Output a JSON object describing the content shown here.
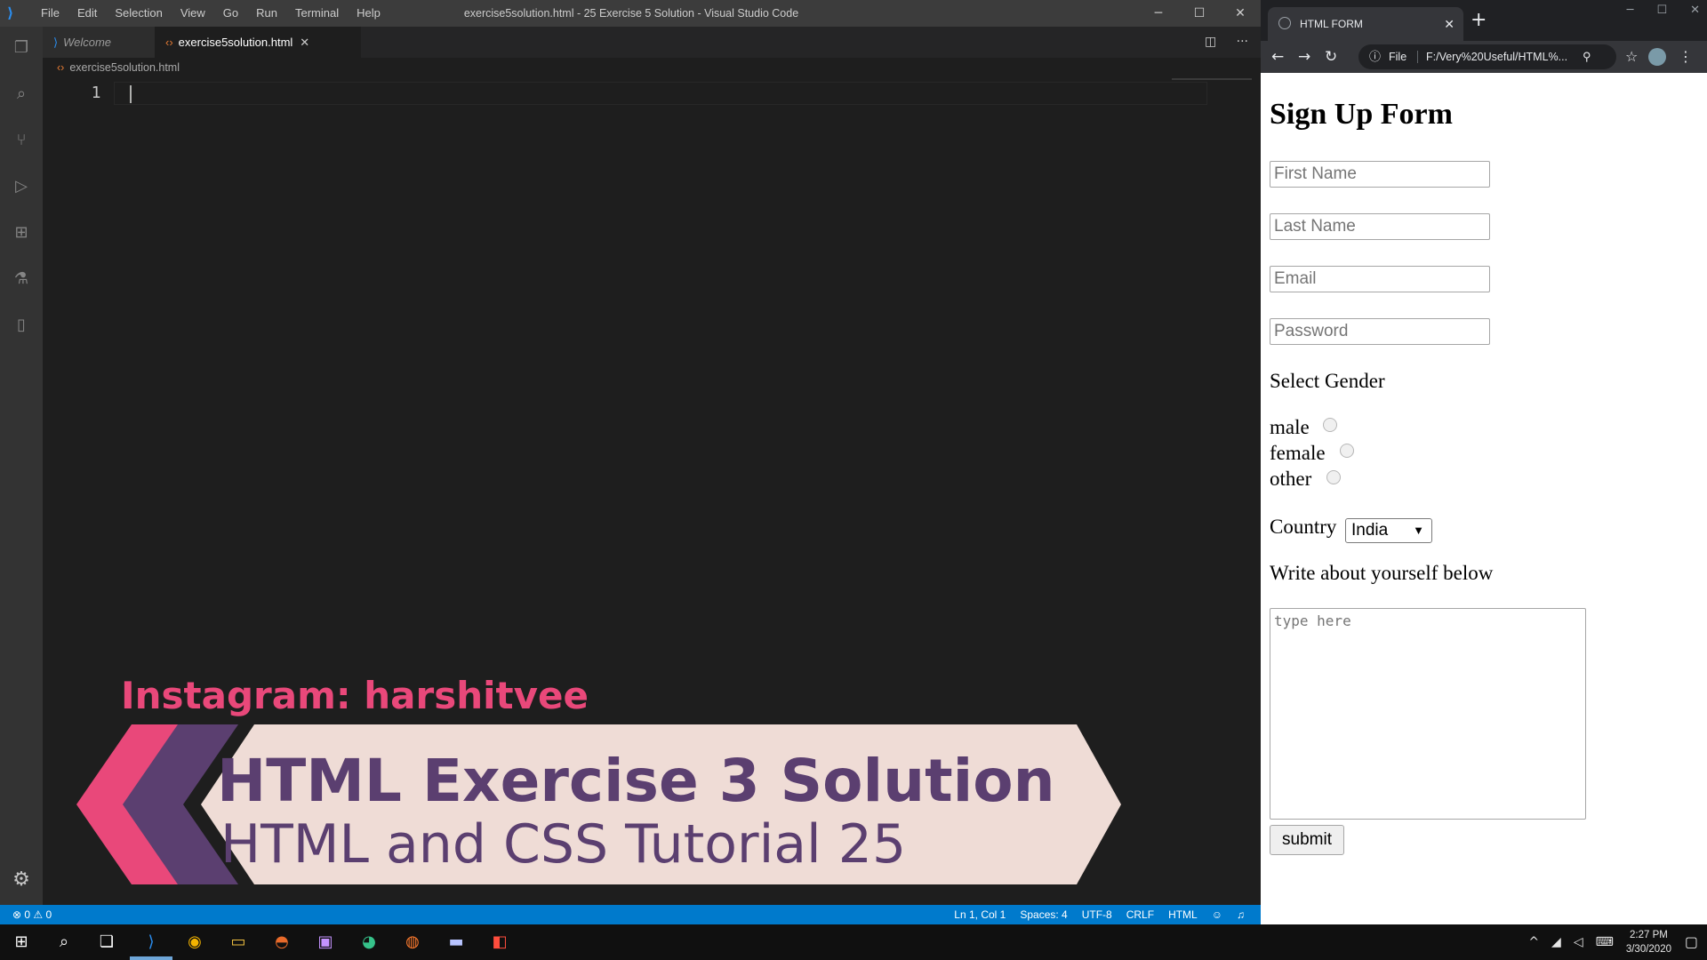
{
  "vscode": {
    "window_title": "exercise5solution.html - 25 Exercise 5 Solution - Visual Studio Code",
    "menu": [
      "File",
      "Edit",
      "Selection",
      "View",
      "Go",
      "Run",
      "Terminal",
      "Help"
    ],
    "tabs": {
      "welcome": "Welcome",
      "file": "exercise5solution.html"
    },
    "breadcrumb": "exercise5solution.html",
    "line_number": "1",
    "status": {
      "problems": "⊗ 0 ⚠ 0",
      "position": "Ln 1, Col 1",
      "spaces": "Spaces: 4",
      "encoding": "UTF-8",
      "eol": "CRLF",
      "language": "HTML"
    }
  },
  "overlay": {
    "instagram": "Instagram: harshitvee",
    "title": "HTML Exercise 3 Solution",
    "subtitle": "HTML and CSS Tutorial 25",
    "colors": {
      "pink": "#e9487a",
      "purple": "#5b3f70",
      "cream": "#efdcd6"
    }
  },
  "browser": {
    "tab_title": "HTML FORM",
    "omnibox": {
      "scheme": "File",
      "url": "F:/Very%20Useful/HTML%..."
    },
    "form": {
      "heading": "Sign Up Form",
      "first_name_placeholder": "First Name",
      "last_name_placeholder": "Last Name",
      "email_placeholder": "Email",
      "password_placeholder": "Password",
      "gender_label": "Select Gender",
      "genders": [
        "male",
        "female",
        "other"
      ],
      "country_label": "Country",
      "country_value": "India",
      "about_label": "Write about yourself below",
      "about_placeholder": "type here",
      "submit_label": "submit"
    }
  },
  "taskbar": {
    "time": "2:27 PM",
    "date": "3/30/2020"
  }
}
